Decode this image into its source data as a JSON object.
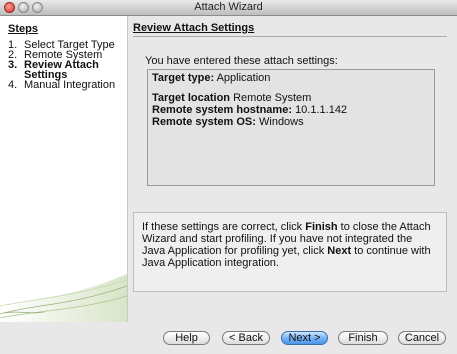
{
  "window": {
    "title": "Attach Wizard"
  },
  "steps": {
    "heading": "Steps",
    "items": [
      {
        "num": "1.",
        "label": "Select Target Type"
      },
      {
        "num": "2.",
        "label": "Remote System"
      },
      {
        "num": "3.",
        "label": "Review Attach Settings"
      },
      {
        "num": "4.",
        "label": "Manual Integration"
      }
    ],
    "current_index": 2
  },
  "content": {
    "heading": "Review Attach Settings",
    "intro": "You have entered these attach settings:",
    "summary": {
      "target_type_label": "Target type:",
      "target_type_value": "Application",
      "target_location_label": "Target location",
      "target_location_value": "Remote System",
      "hostname_label": "Remote system hostname:",
      "hostname_value": "10.1.1.142",
      "os_label": "Remote system OS:",
      "os_value": "Windows"
    },
    "info": {
      "part1": "If these settings are correct, click ",
      "finish_word": "Finish",
      "part2": " to close the Attach Wizard and start profiling. If you have not integrated the Java Application for profiling yet, click ",
      "next_word": "Next",
      "part3": " to continue with Java Application integration."
    }
  },
  "buttons": {
    "help": "Help",
    "back": "< Back",
    "next": "Next >",
    "finish": "Finish",
    "cancel": "Cancel"
  },
  "colors": {
    "accent_default_button": "#6fb0f4",
    "close_button": "#d3342a"
  }
}
